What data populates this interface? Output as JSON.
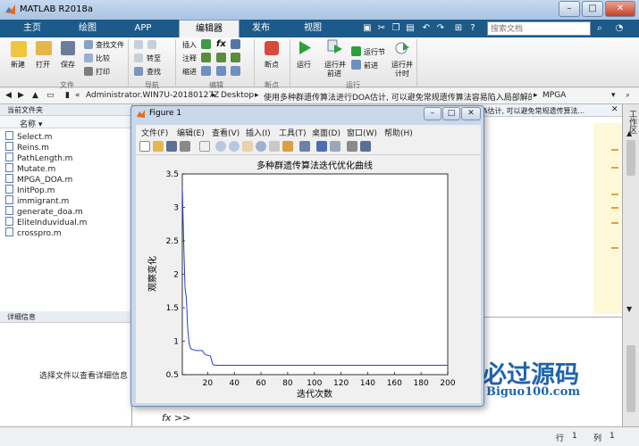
{
  "window": {
    "title": "MATLAB R2018a",
    "min_label": "–",
    "max_label": "□",
    "close_label": "✕"
  },
  "tabs": [
    {
      "label": "主页"
    },
    {
      "label": "绘图"
    },
    {
      "label": "APP"
    },
    {
      "label": "编辑器"
    },
    {
      "label": "发布"
    },
    {
      "label": "视图"
    }
  ],
  "search": {
    "placeholder": "搜索文档"
  },
  "ribbon": {
    "new": "新建",
    "open": "打开",
    "save": "保存",
    "find_files": "查找文件",
    "compare": "比较",
    "print": "打印",
    "goto": "转至",
    "find": "查找",
    "insert": "插入",
    "comment": "注释",
    "indent": "缩进",
    "fx": "fx",
    "breakpoints": "断点",
    "run": "运行",
    "run_advance": "运行并",
    "advance": "前进",
    "run_section": "运行节",
    "run_advance2": "前进",
    "run_time": "运行并",
    "timing": "计时",
    "run_advance_sub": "前进",
    "timing_sub": "计时"
  },
  "groups": {
    "file": "文件",
    "navigate": "导航",
    "edit": "编辑",
    "breakpoints": "断点",
    "run": "运行"
  },
  "path": {
    "prefix": "«",
    "segments": [
      "Administrator.WIN7U-20180127Z",
      "Desktop",
      "使用多种群遗传算法进行DOA估计, 可以避免常规遗传算法容易陷入局部解的问题",
      "MPGA"
    ]
  },
  "current_folder": {
    "title": "当前文件夹",
    "name_col": "名称 ▾",
    "files": [
      "Select.m",
      "Reins.m",
      "PathLength.m",
      "Mutate.m",
      "MPGA_DOA.m",
      "InitPop.m",
      "immigrant.m",
      "generate_doa.m",
      "EliteInduvidual.m",
      "crosspro.m"
    ]
  },
  "details": {
    "title": "详细信息",
    "message": "选择文件以查看详细信息"
  },
  "editor": {
    "tab_text": "A估计, 可以避免常规遗传算法..."
  },
  "workspace": {
    "label": "工作区"
  },
  "command": {
    "prompt": "fx >>"
  },
  "status": {
    "row_label": "行",
    "row": "1",
    "col_label": "列",
    "col": "1"
  },
  "figure": {
    "title": "Figure 1",
    "menu": [
      "文件(F)",
      "编辑(E)",
      "查看(V)",
      "插入(I)",
      "工具(T)",
      "桌面(D)",
      "窗口(W)",
      "帮助(H)"
    ]
  },
  "watermark": {
    "text": "必过源码",
    "sub": "Biguo100.com"
  },
  "chart_data": {
    "type": "line",
    "title": "多种群遗传算法迭代优化曲线",
    "xlabel": "迭代次数",
    "ylabel": "观察变化",
    "xlim": [
      1,
      200
    ],
    "ylim": [
      0.5,
      3.5
    ],
    "xticks": [
      20,
      40,
      60,
      80,
      100,
      120,
      140,
      160,
      180,
      200
    ],
    "yticks": [
      0.5,
      1,
      1.5,
      2,
      2.5,
      3,
      3.5
    ],
    "series": [
      {
        "x": [
          1,
          2,
          3,
          4,
          5,
          6,
          7,
          8,
          10,
          12,
          14,
          16,
          18,
          20,
          22,
          24,
          26,
          30,
          35,
          40,
          60,
          80,
          100,
          150,
          200
        ],
        "y": [
          3.3,
          2.5,
          1.8,
          1.65,
          1.2,
          0.98,
          0.9,
          0.88,
          0.87,
          0.86,
          0.86,
          0.86,
          0.8,
          0.79,
          0.78,
          0.65,
          0.64,
          0.64,
          0.64,
          0.64,
          0.64,
          0.64,
          0.64,
          0.64,
          0.64
        ]
      }
    ],
    "line_color": "#1f3fd0"
  }
}
